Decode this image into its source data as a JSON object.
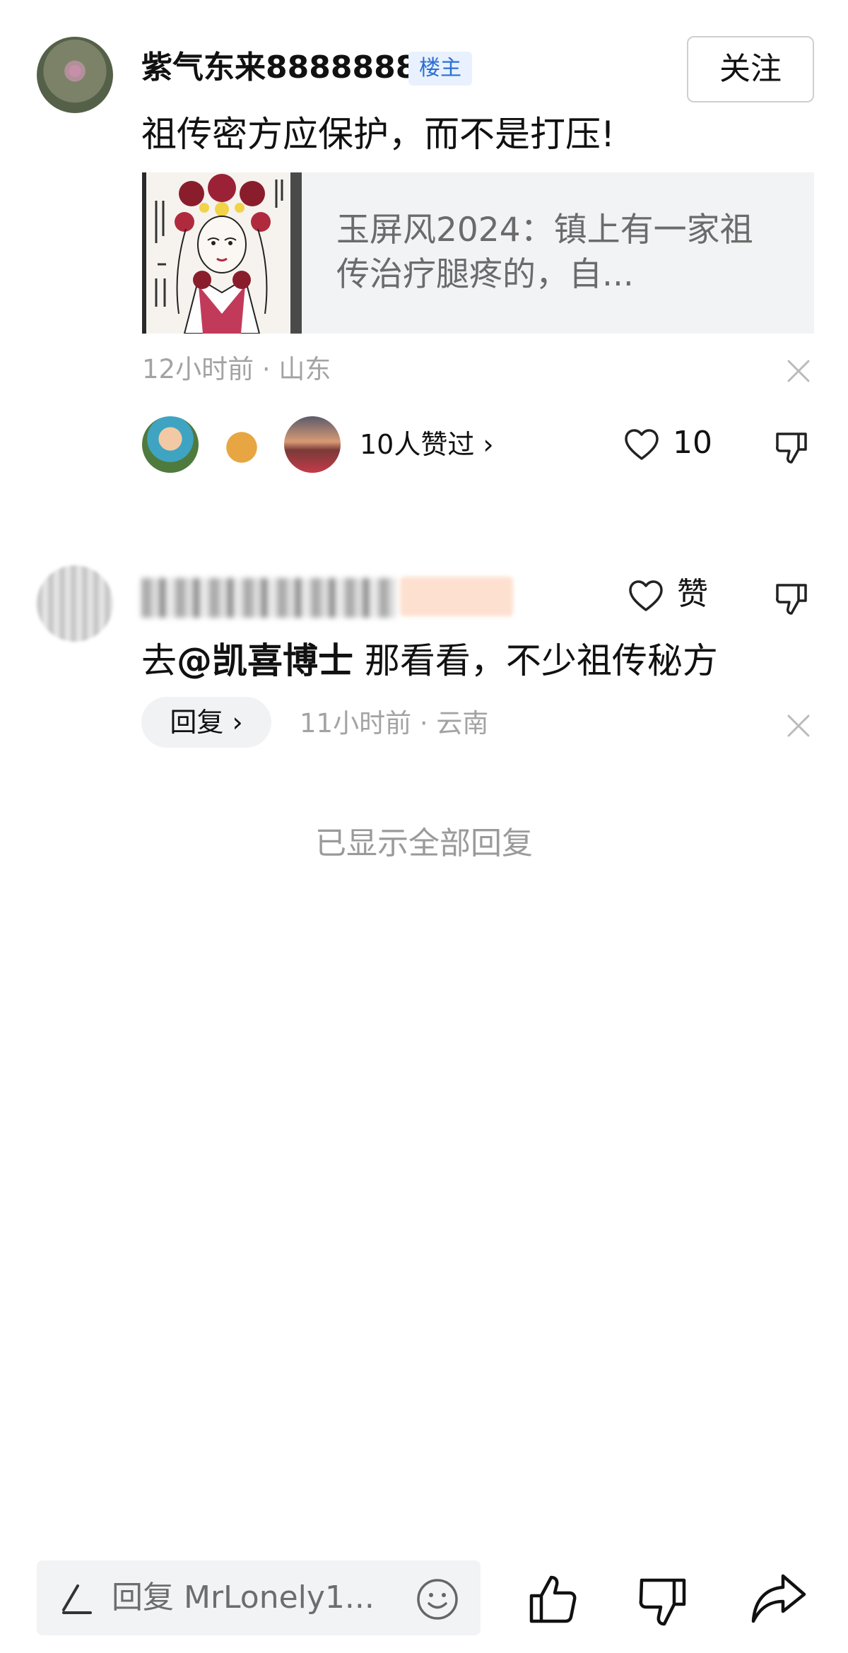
{
  "main_comment": {
    "author": "紫气东来8888888",
    "badge": "楼主",
    "follow_label": "关注",
    "text": "祖传密方应保护，而不是打压!",
    "quote": {
      "text": "玉屏风2024：镇上有一家祖传治疗腿疼的，自...",
      "thumbnail_icon": "opera-drawing-thumbnail"
    },
    "time": "12小时前",
    "location": "山东",
    "likers_text": "10人赞过 ›",
    "like_count": "10"
  },
  "reply": {
    "like_label": "赞",
    "text_prefix": "去",
    "mention": "@凯喜博士",
    "text_suffix": " 那看看，不少祖传秘方",
    "reply_button": "回复 ›",
    "time": "11小时前",
    "location": "云南"
  },
  "all_replies_shown": "已显示全部回复",
  "bottom_bar": {
    "input_placeholder": "回复 MrLonely1...",
    "icons": [
      "pen-icon",
      "emoji-icon",
      "thumbs-up-icon",
      "thumbs-down-icon",
      "share-icon"
    ]
  },
  "colors": {
    "badge_blue": "#2b6fd6",
    "meta_gray": "#a3a3a3",
    "card_bg": "#f2f3f5"
  }
}
